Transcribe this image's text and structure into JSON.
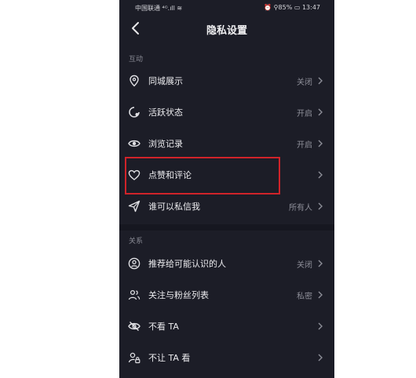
{
  "status": {
    "carrier": "中国联通 ⁴ᴳ.ıll ≋",
    "right": "⏰ ⚲85% ▭ 13:47"
  },
  "header": {
    "title": "隐私设置"
  },
  "sections": [
    {
      "title": "互动",
      "items": [
        {
          "label": "同城展示",
          "value": "关闭",
          "icon": "location-pin-icon"
        },
        {
          "label": "活跃状态",
          "value": "开启",
          "icon": "activity-status-icon"
        },
        {
          "label": "浏览记录",
          "value": "开启",
          "icon": "eye-icon"
        },
        {
          "label": "点赞和评论",
          "value": "",
          "icon": "heart-icon"
        },
        {
          "label": "谁可以私信我",
          "value": "所有人",
          "icon": "send-icon"
        }
      ]
    },
    {
      "title": "关系",
      "items": [
        {
          "label": "推荐给可能认识的人",
          "value": "关闭",
          "icon": "user-circle-icon"
        },
        {
          "label": "关注与粉丝列表",
          "value": "私密",
          "icon": "users-icon"
        },
        {
          "label": "不看 TA",
          "value": "",
          "icon": "eye-off-icon"
        },
        {
          "label": "不让 TA 看",
          "value": "",
          "icon": "user-lock-icon"
        }
      ]
    }
  ],
  "colors": {
    "background": "#1c1d27",
    "highlight": "#d0232a"
  }
}
